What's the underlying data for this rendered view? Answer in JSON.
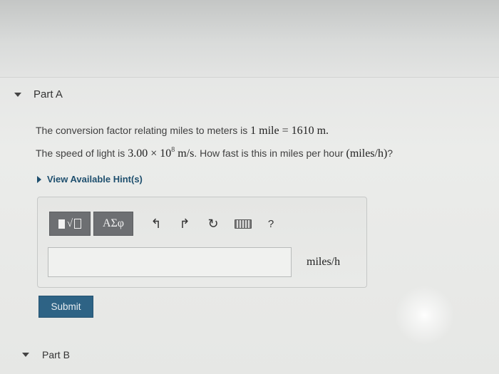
{
  "part_a": {
    "title": "Part A"
  },
  "question": {
    "line1_prefix": "The conversion factor relating miles to meters is ",
    "line1_math": "1 mile = 1610 m.",
    "line2_prefix": "The speed of light is ",
    "line2_coeff": "3.00 × 10",
    "line2_exp": "8",
    "line2_unit": " m/s",
    "line2_mid": ". How fast is this in miles per hour ",
    "line2_math": "(miles/h)",
    "line2_suffix": "?"
  },
  "hint": {
    "label": "View Available Hint(s)"
  },
  "toolbar": {
    "templates_root": "√",
    "symbols_label": "ΑΣφ",
    "undo_glyph": "↰",
    "redo_glyph": "↱",
    "reset_glyph": "↻",
    "help_label": "?"
  },
  "answer": {
    "value": "",
    "placeholder": "",
    "unit": "miles/h"
  },
  "submit": {
    "label": "Submit"
  },
  "part_b": {
    "title": "Part B"
  },
  "icons": {
    "collapse": "caret-down-icon",
    "expand": "caret-right-icon",
    "undo": "undo-icon",
    "redo": "redo-icon",
    "reset": "reset-icon",
    "keyboard": "keyboard-icon"
  },
  "colors": {
    "accent": "#1e4f6e",
    "button": "#2e6385",
    "toolbar": "#6d6f72"
  }
}
